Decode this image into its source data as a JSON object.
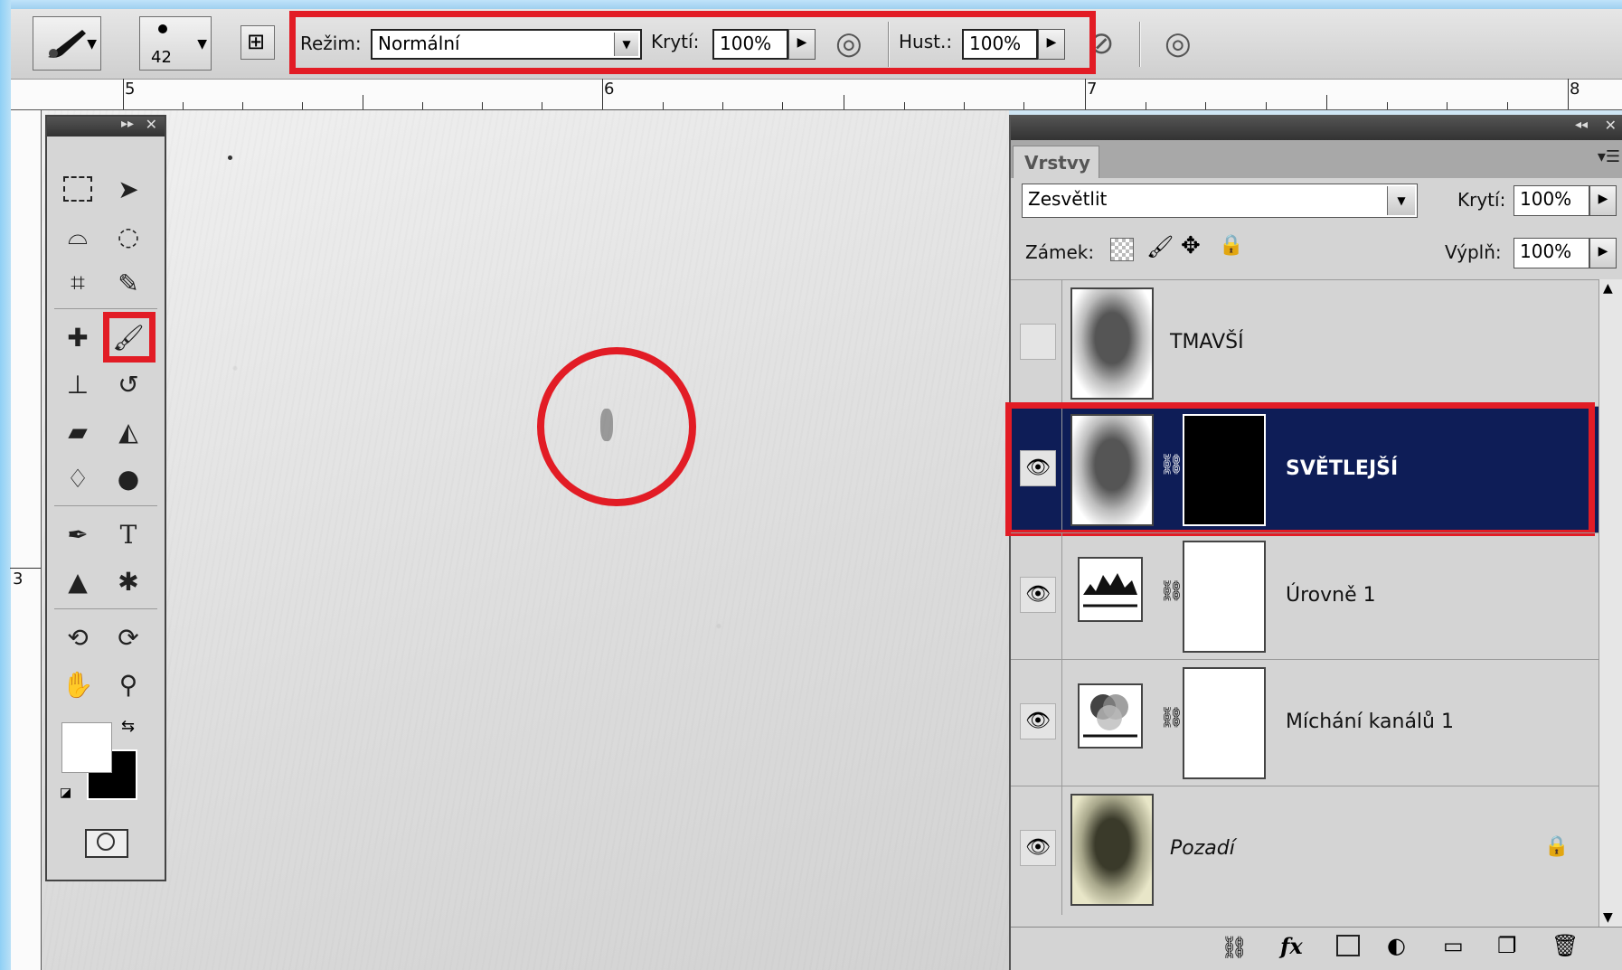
{
  "options_bar": {
    "brush_size": "42",
    "mode_label": "Režim:",
    "mode_value": "Normální",
    "opacity_label": "Krytí:",
    "opacity_value": "100%",
    "flow_label": "Hust.:",
    "flow_value": "100%"
  },
  "ruler": {
    "labels": [
      "5",
      "6",
      "7",
      "8"
    ],
    "vertical_label": "3"
  },
  "layers_panel": {
    "tab": "Vrstvy",
    "blend_mode": "Zesvětlit",
    "opacity_label": "Krytí:",
    "opacity_value": "100%",
    "lock_label": "Zámek:",
    "fill_label": "Výplň:",
    "fill_value": "100%",
    "layers": [
      {
        "name": "TMAVŠÍ",
        "visible": false,
        "selected": false
      },
      {
        "name": "SVĚTLEJŠÍ",
        "visible": true,
        "selected": true
      },
      {
        "name": "Úrovně 1",
        "visible": true,
        "selected": false
      },
      {
        "name": "Míchání kanálů 1",
        "visible": true,
        "selected": false
      },
      {
        "name": "Pozadí",
        "visible": true,
        "selected": false
      }
    ]
  },
  "colors": {
    "highlight": "#e21c25",
    "selected_layer": "#0e1d57"
  }
}
